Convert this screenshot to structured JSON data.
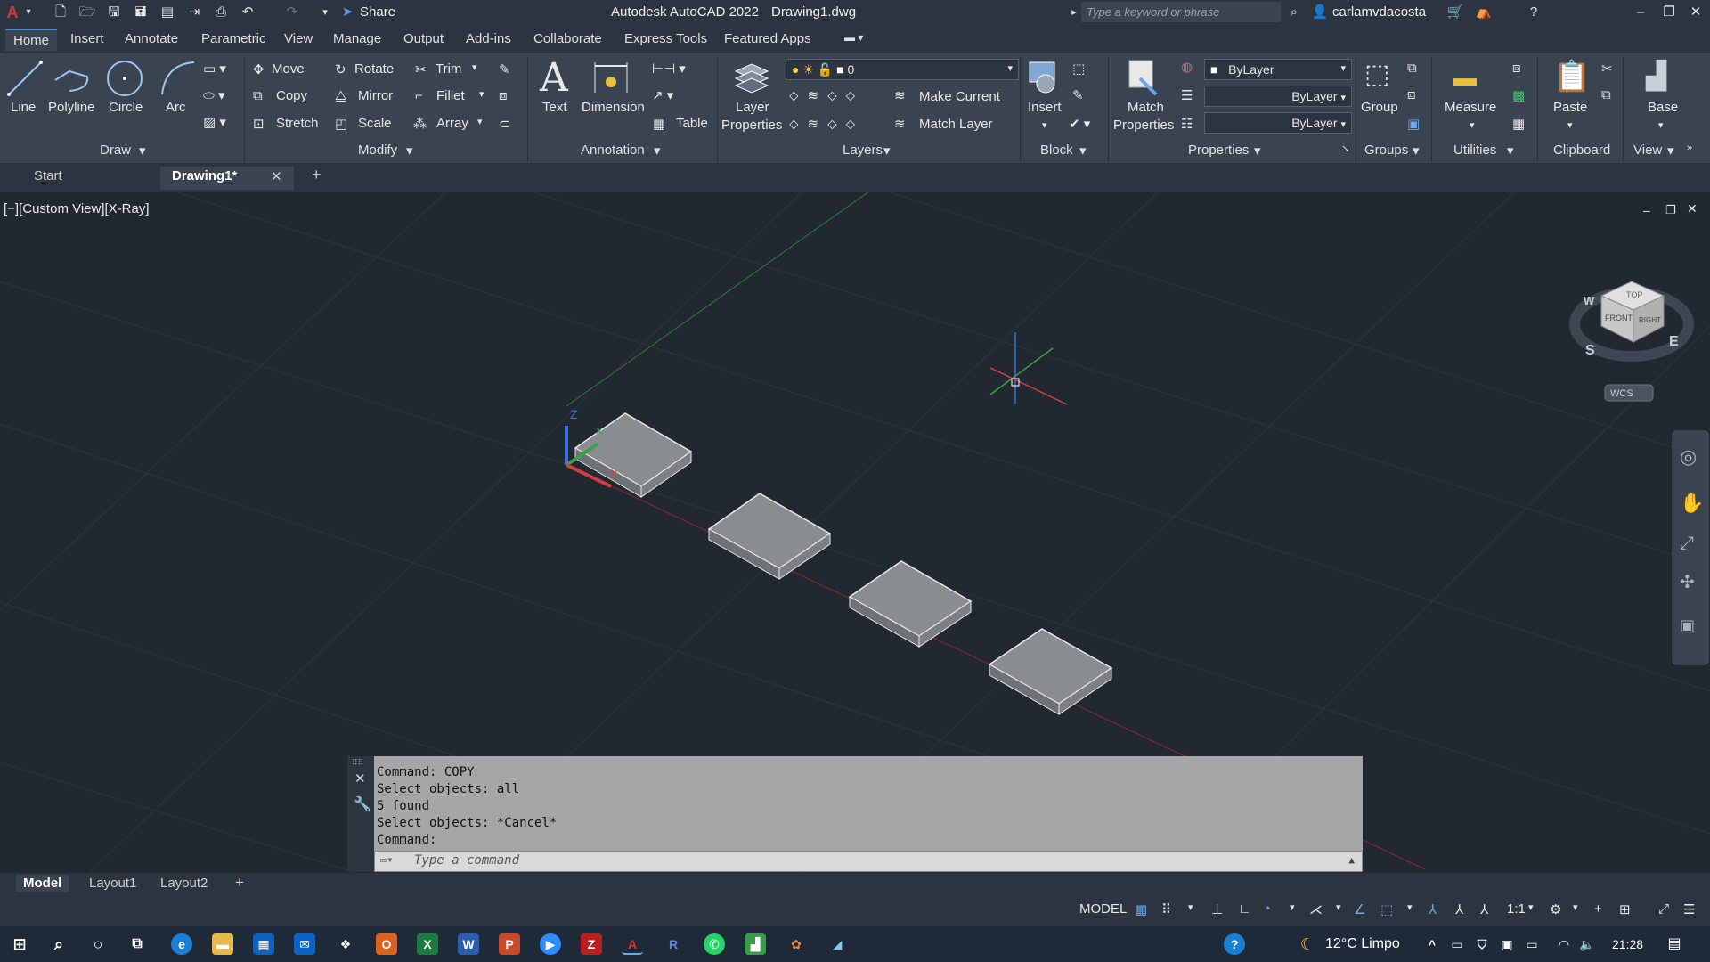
{
  "titlebar": {
    "app_title": "Autodesk AutoCAD 2022",
    "file_title": "Drawing1.dwg",
    "share_label": "Share",
    "search_placeholder": "Type a keyword or phrase",
    "user": "carlamvdacosta"
  },
  "ribbon_tabs": [
    "Home",
    "Insert",
    "Annotate",
    "Parametric",
    "View",
    "Manage",
    "Output",
    "Add-ins",
    "Collaborate",
    "Express Tools",
    "Featured Apps"
  ],
  "ribbon": {
    "draw": {
      "line": "Line",
      "polyline": "Polyline",
      "circle": "Circle",
      "arc": "Arc",
      "panel": "Draw"
    },
    "modify": {
      "move": "Move",
      "rotate": "Rotate",
      "trim": "Trim",
      "copy": "Copy",
      "mirror": "Mirror",
      "fillet": "Fillet",
      "stretch": "Stretch",
      "scale": "Scale",
      "array": "Array",
      "panel": "Modify"
    },
    "annotation": {
      "text": "Text",
      "dimension": "Dimension",
      "table": "Table",
      "panel": "Annotation"
    },
    "layers": {
      "layer_properties_1": "Layer",
      "layer_properties_2": "Properties",
      "current_layer": "0",
      "make_current": "Make Current",
      "match_layer": "Match Layer",
      "panel": "Layers"
    },
    "block": {
      "insert": "Insert",
      "panel": "Block"
    },
    "properties": {
      "match_1": "Match",
      "match_2": "Properties",
      "color": "ByLayer",
      "lineweight": "ByLayer",
      "linetype": "ByLayer",
      "panel": "Properties"
    },
    "groups": {
      "group": "Group",
      "panel": "Groups"
    },
    "utilities": {
      "measure": "Measure",
      "panel": "Utilities"
    },
    "clipboard": {
      "paste": "Paste",
      "panel": "Clipboard"
    },
    "view": {
      "base": "Base",
      "panel": "View"
    }
  },
  "file_tabs": {
    "start": "Start",
    "drawing": "Drawing1*"
  },
  "viewport": {
    "label": "[−][Custom View][X-Ray]",
    "viewcube": {
      "top": "TOP",
      "front": "FRONT",
      "right": "RIGHT",
      "south": "S",
      "east": "E",
      "west": "W",
      "wcs": "WCS"
    },
    "ucs_z": "Z"
  },
  "command": {
    "history": [
      "Command: COPY",
      "Select objects: all",
      "5 found",
      "Select objects: *Cancel*",
      "Command:"
    ],
    "placeholder": "Type a command"
  },
  "layout_tabs": [
    "Model",
    "Layout1",
    "Layout2"
  ],
  "status": {
    "model": "MODEL",
    "scale": "1:1"
  },
  "taskbar": {
    "weather": "12°C  Limpo",
    "time": "21:28"
  },
  "colors": {
    "accent": "#4a90d9",
    "canvas": "#212830",
    "ribbon": "#3a4350"
  }
}
